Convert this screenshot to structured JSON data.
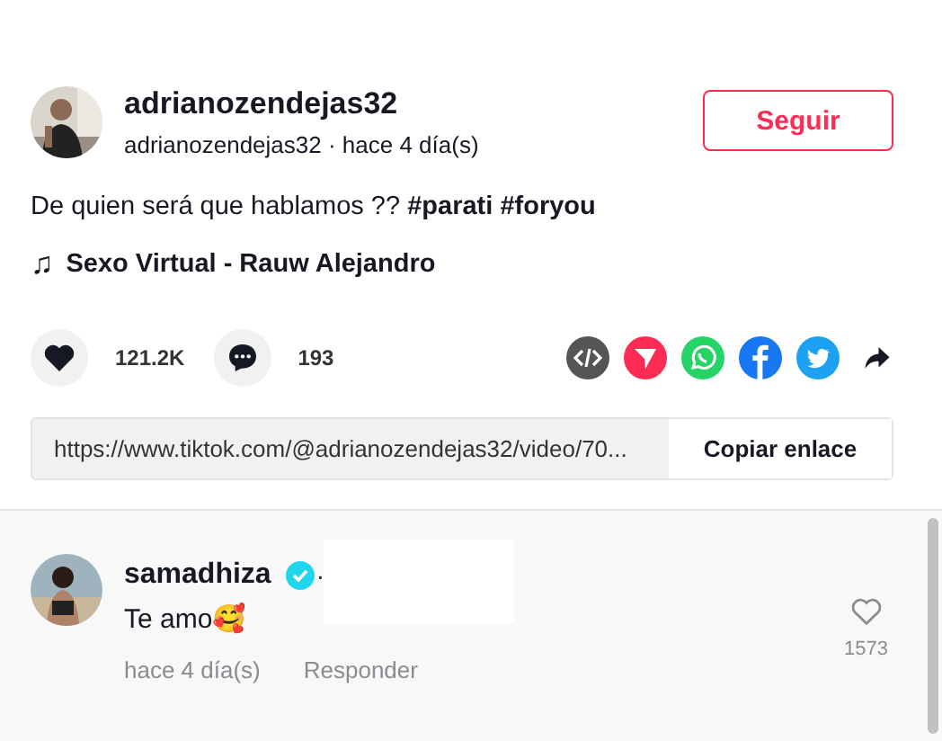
{
  "post": {
    "username": "adrianozendejas32",
    "subline": "adrianozendejas32 · hace 4 día(s)",
    "follow_button": "Seguir",
    "caption": "De quien será que hablamos ?? **#parati** **#foryou**",
    "music_icon": "♫",
    "music": "Sexo Virtual - Rauw Alejandro"
  },
  "actions": {
    "likes": "121.2K",
    "comments": "193"
  },
  "share": [
    {
      "kind": "embed"
    },
    {
      "kind": "send"
    },
    {
      "kind": "whatsapp"
    },
    {
      "kind": "facebook"
    },
    {
      "kind": "twitter"
    },
    {
      "kind": "forward"
    }
  ],
  "link": {
    "url": "https://www.tiktok.com/@adrianozendejas32/video/70...",
    "copy_button": "Copiar enlace"
  },
  "comments": [
    {
      "username": "samadhiza",
      "verified": true,
      "separator": "·",
      "text": "Te amo🥰",
      "time": "hace 4 día(s)",
      "reply": "Responder",
      "likes": "1573"
    }
  ]
}
